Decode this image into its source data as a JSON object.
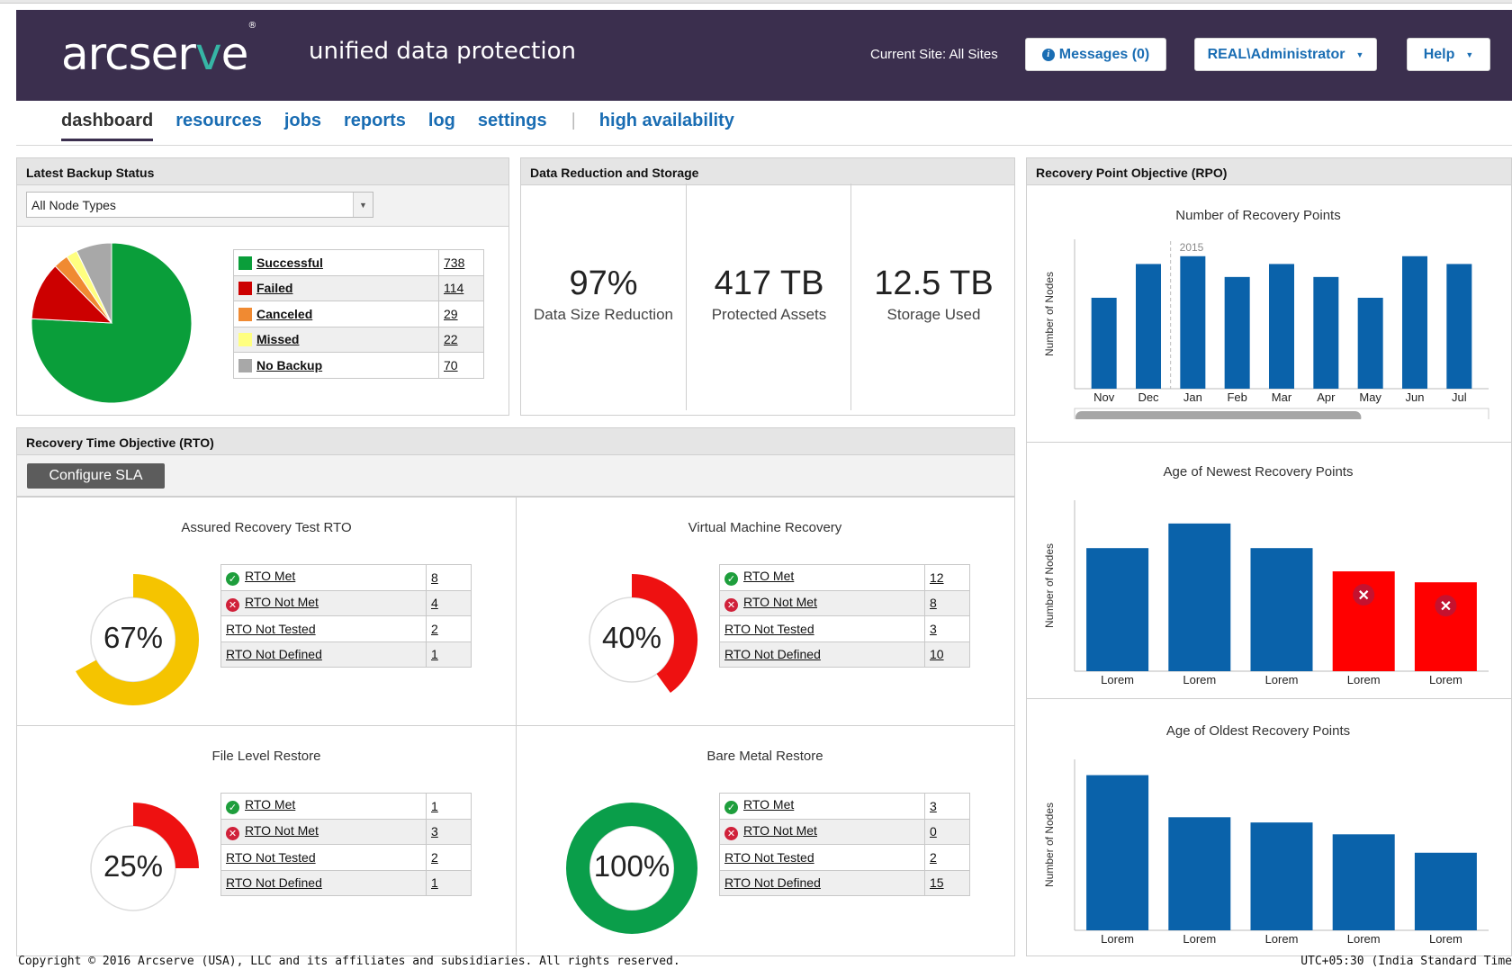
{
  "app": {
    "logo_pre": "arcser",
    "logo_v": "v",
    "logo_post": "e",
    "logo_mark": "®",
    "product": "unified data protection",
    "current_site": "Current Site: All Sites",
    "messages_label": "Messages (0)",
    "user_label": "REAL\\Administrator",
    "help_label": "Help"
  },
  "nav": {
    "items": [
      "dashboard",
      "resources",
      "jobs",
      "reports",
      "log",
      "settings",
      "high availability"
    ],
    "active": "dashboard",
    "separator": "|"
  },
  "backup_status": {
    "title": "Latest Backup Status",
    "filter_value": "All Node Types",
    "rows": [
      {
        "label": "Successful",
        "value": "738",
        "color": "#0a9e3a"
      },
      {
        "label": "Failed",
        "value": "114",
        "color": "#cc0000"
      },
      {
        "label": "Canceled",
        "value": "29",
        "color": "#f08a32"
      },
      {
        "label": "Missed",
        "value": "22",
        "color": "#ffff80"
      },
      {
        "label": "No Backup",
        "value": "70",
        "color": "#a8a8a8"
      }
    ]
  },
  "data_reduction": {
    "title": "Data Reduction and Storage",
    "stats": [
      {
        "value": "97%",
        "label": "Data Size Reduction"
      },
      {
        "value": "417 TB",
        "label": "Protected Assets"
      },
      {
        "value": "12.5 TB",
        "label": "Storage Used"
      }
    ]
  },
  "rto": {
    "title": "Recovery Time Objective (RTO)",
    "configure_label": "Configure SLA",
    "row_labels": [
      "RTO Met",
      "RTO Not Met",
      "RTO Not Tested",
      "RTO Not Defined"
    ],
    "cells": [
      {
        "title": "Assured Recovery Test RTO",
        "percent": 67,
        "percent_label": "67%",
        "color": "#f5c400",
        "values": [
          "8",
          "4",
          "2",
          "1"
        ]
      },
      {
        "title": "Virtual Machine Recovery",
        "percent": 40,
        "percent_label": "40%",
        "color": "#ee1111",
        "values": [
          "12",
          "8",
          "3",
          "10"
        ]
      },
      {
        "title": "File Level Restore",
        "percent": 25,
        "percent_label": "25%",
        "color": "#ee1111",
        "values": [
          "1",
          "3",
          "2",
          "1"
        ]
      },
      {
        "title": "Bare Metal Restore",
        "percent": 100,
        "percent_label": "100%",
        "color": "#0a9e4a",
        "values": [
          "3",
          "0",
          "2",
          "15"
        ]
      }
    ]
  },
  "rpo": {
    "title": "Recovery Point Objective (RPO)",
    "ylabel": "Number of Nodes"
  },
  "chart_data": [
    {
      "type": "pie",
      "title": "",
      "categories": [
        "Successful",
        "Failed",
        "Canceled",
        "Missed",
        "No Backup"
      ],
      "values": [
        738,
        114,
        29,
        22,
        70
      ],
      "colors": [
        "#0a9e3a",
        "#cc0000",
        "#f08a32",
        "#ffff80",
        "#a8a8a8"
      ]
    },
    {
      "type": "bar",
      "title": "Number of Recovery Points",
      "ylabel": "Number of Nodes",
      "year_marker": "2015",
      "year_marker_before": "Jan",
      "categories": [
        "Nov",
        "Dec",
        "Jan",
        "Feb",
        "Mar",
        "Apr",
        "May",
        "Jun",
        "Jul"
      ],
      "values": [
        70,
        96,
        102,
        86,
        96,
        86,
        70,
        102,
        96
      ],
      "ylim": [
        0,
        115
      ],
      "color": "#0a62aa"
    },
    {
      "type": "bar",
      "title": "Age of Newest Recovery Points",
      "ylabel": "Number of Nodes",
      "categories": [
        "Lorem",
        "Lorem",
        "Lorem",
        "Lorem",
        "Lorem"
      ],
      "values": [
        90,
        108,
        90,
        73,
        65
      ],
      "ylim": [
        0,
        125
      ],
      "colors": [
        "#0a62aa",
        "#0a62aa",
        "#0a62aa",
        "#ff0000",
        "#ff0000"
      ],
      "alerts": [
        false,
        false,
        false,
        true,
        true
      ]
    },
    {
      "type": "bar",
      "title": "Age of Oldest Recovery Points",
      "ylabel": "Number of Nodes",
      "categories": [
        "Lorem",
        "Lorem",
        "Lorem",
        "Lorem",
        "Lorem"
      ],
      "values": [
        118,
        86,
        82,
        73,
        59
      ],
      "ylim": [
        0,
        130
      ],
      "color": "#0a62aa"
    }
  ],
  "footer": {
    "copyright": "Copyright © 2016 Arcserve (USA), LLC and its affiliates and subsidiaries. All rights reserved.",
    "timezone": "UTC+05:30 (India Standard Time"
  }
}
